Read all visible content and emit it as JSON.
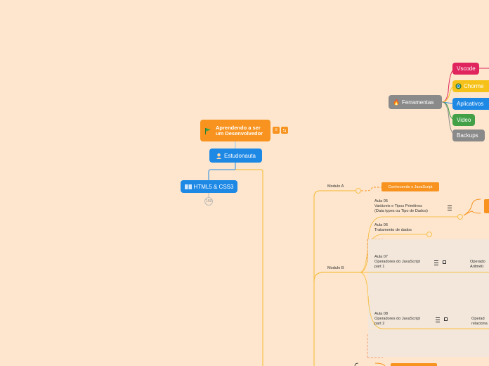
{
  "root": {
    "title": "Aprendendo a ser um Desenvolvedor"
  },
  "nodes": {
    "estudonauta": "Estudonauta",
    "html_css": "HTML5 & CSS3",
    "html_css_count": "168",
    "ferramentas": "Ferramentas",
    "vscode": "Vscode",
    "chrome": "Chorme",
    "aplicativos": "Aplicativos",
    "video": "Video",
    "backups": "Backups"
  },
  "modules": {
    "modulo_a": "Modulo  A",
    "modulo_a_topic": "Conhecendo o JavaScript",
    "modulo_b": "Modulo B",
    "aula05": "Aula 05",
    "aula05_title": "Variáveis e Tipos Primitivos",
    "aula05_sub": "(Data types ou Tipo de Dados)",
    "aula06": "Aula 06",
    "aula06_title": "Tratamento de dados",
    "aula07": "Aula 07",
    "aula07_title": "Operadores do JavaScript",
    "aula07_sub": " part  1",
    "aula07_right": "Operado",
    "aula07_right2": "Aritméti",
    "aula08": "Aula 08",
    "aula08_title": "Operadores do JavaScript",
    "aula08_sub": "part 2",
    "aula08_right": "Operad",
    "aula08_right2": "relaciona"
  },
  "colors": {
    "background": "#fde6cd",
    "orange": "#f7931e",
    "blue": "#1e88e5",
    "gray": "#8a8a8a",
    "pink": "#e0245e",
    "yellow": "#f6c21a",
    "green": "#43a047",
    "line_yellow": "#f7c04a"
  }
}
